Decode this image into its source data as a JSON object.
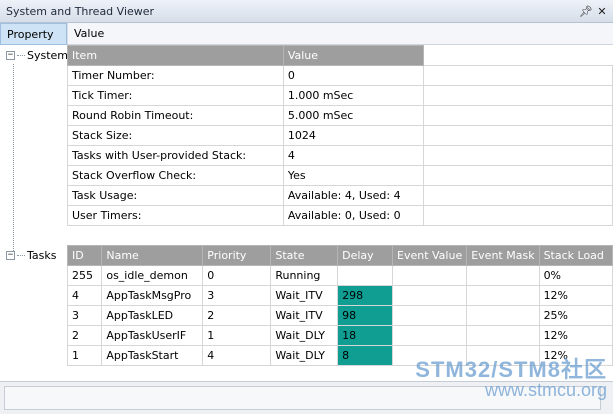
{
  "window": {
    "title": "System and Thread Viewer",
    "pin_icon": "pin-icon",
    "close_icon": "close-icon"
  },
  "header": {
    "property": "Property",
    "value": "Value"
  },
  "tree": {
    "system_label": "System",
    "tasks_label": "Tasks",
    "expander_symbol": "−"
  },
  "system": {
    "columns": [
      "Item",
      "Value"
    ],
    "rows": [
      [
        "Timer Number:",
        "0"
      ],
      [
        "Tick Timer:",
        "1.000 mSec"
      ],
      [
        "Round Robin Timeout:",
        "5.000 mSec"
      ],
      [
        "Stack Size:",
        "1024"
      ],
      [
        "Tasks with User-provided Stack:",
        "4"
      ],
      [
        "Stack Overflow Check:",
        "Yes"
      ],
      [
        "Task Usage:",
        "Available: 4, Used: 4"
      ],
      [
        "User Timers:",
        "Available: 0, Used: 0"
      ]
    ]
  },
  "tasks": {
    "columns": [
      "ID",
      "Name",
      "Priority",
      "State",
      "Delay",
      "Event Value",
      "Event Mask",
      "Stack Load"
    ],
    "rows": [
      [
        "255",
        "os_idle_demon",
        "0",
        "Running",
        "",
        "",
        "",
        "0%"
      ],
      [
        "4",
        "AppTaskMsgPro",
        "3",
        "Wait_ITV",
        "298",
        "",
        "",
        "12%"
      ],
      [
        "3",
        "AppTaskLED",
        "2",
        "Wait_ITV",
        "98",
        "",
        "",
        "25%"
      ],
      [
        "2",
        "AppTaskUserIF",
        "1",
        "Wait_DLY",
        "18",
        "",
        "",
        "12%"
      ],
      [
        "1",
        "AppTaskStart",
        "4",
        "Wait_DLY",
        "8",
        "",
        "",
        "12%"
      ]
    ],
    "highlight_color": "#109e93"
  },
  "watermark": {
    "line1": "STM32/STM8社区",
    "line2": "www.stmcu.org"
  }
}
